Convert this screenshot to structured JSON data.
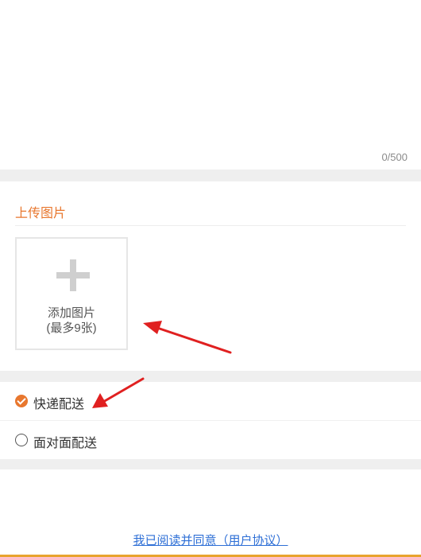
{
  "description": {
    "char_count": "0/500"
  },
  "upload": {
    "title": "上传图片",
    "add_label_line1": "添加图片",
    "add_label_line2": "(最多9张)"
  },
  "delivery": {
    "options": [
      {
        "label": "快递配送",
        "selected": true
      },
      {
        "label": "面对面配送",
        "selected": false
      }
    ]
  },
  "footer": {
    "agreement": "我已阅读并同意（用户协议）"
  },
  "colors": {
    "accent": "#e8772e",
    "link": "#2e6fd6",
    "annotation_arrow": "#e02020"
  }
}
